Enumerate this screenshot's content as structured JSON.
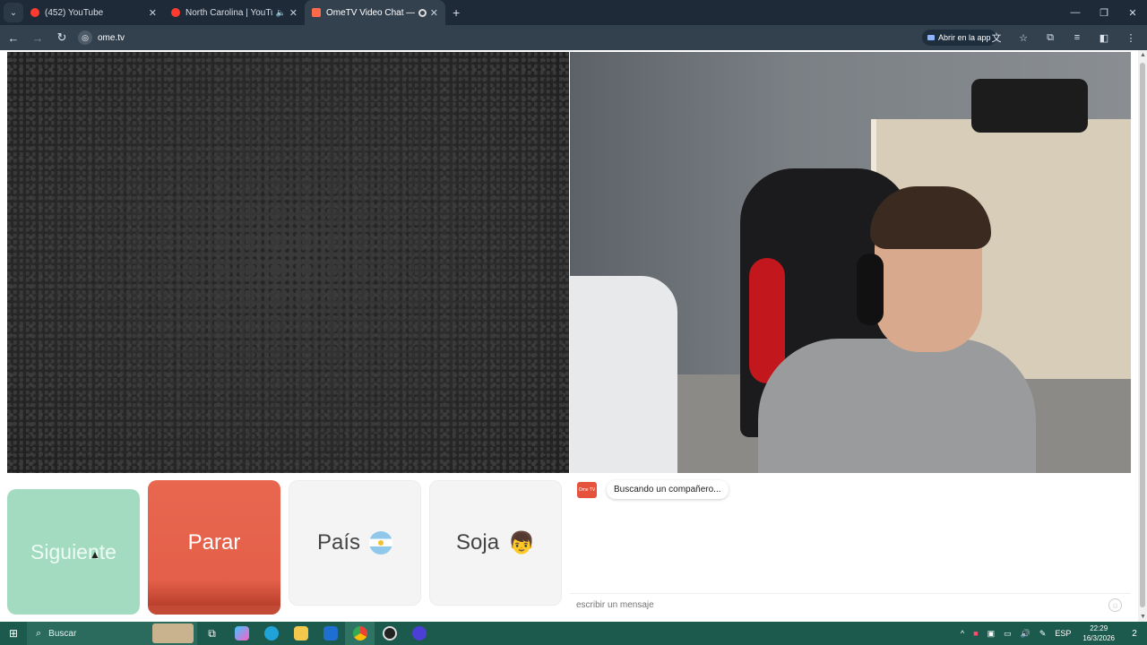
{
  "browser": {
    "tabs": [
      {
        "label": "(452) YouTube",
        "color": "#ff3b30"
      },
      {
        "label": "North Carolina | YouTube M",
        "color": "#ff3b30"
      },
      {
        "label": "OmeTV Video Chat — Alte",
        "color": "#ff6b4a"
      }
    ],
    "new_tab": "+",
    "url": "ome.tv",
    "open_app_label": "Abrir en la app"
  },
  "buttons": {
    "next": "Siguiente",
    "stop": "Parar",
    "country": "País",
    "gender": "Soja"
  },
  "chat": {
    "logo_text": "Ome TV",
    "status_message": "Buscando un compañero...",
    "input_placeholder": "escribir un mensaje"
  },
  "taskbar": {
    "search_label": "Buscar",
    "language": "ESP",
    "time": "22:29",
    "date": "16/3/2026",
    "notification_count": "2"
  },
  "colors": {
    "next_button": "#a3dbc0",
    "stop_button": "#e8674f",
    "taskbar": "#1c5a4d"
  }
}
